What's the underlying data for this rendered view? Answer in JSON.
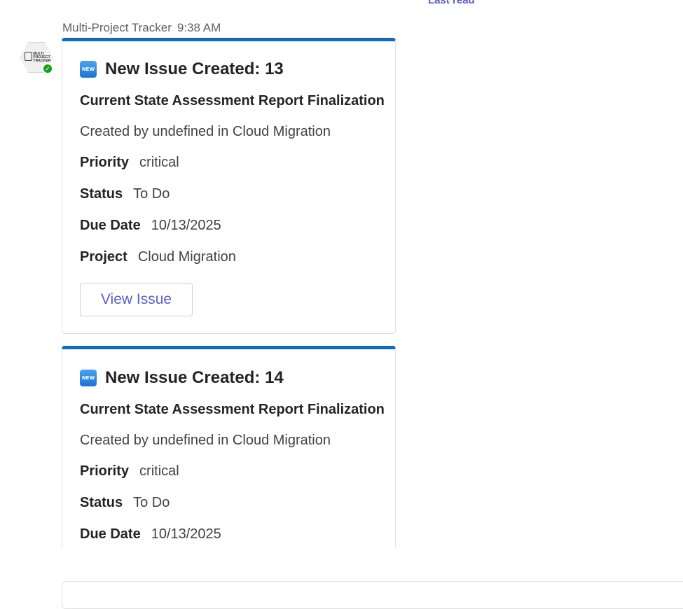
{
  "divider": {
    "last_read_label": "Last read"
  },
  "message": {
    "sender": "Multi-Project Tracker",
    "time": "9:38 AM",
    "avatar": {
      "label_lines": [
        "MULTI",
        "PROJECT",
        "TRACKER"
      ],
      "icon": "clipboard-check-icon",
      "presence": "available",
      "presence_color": "#13a10e"
    }
  },
  "colors": {
    "accent": "#0f6cbd",
    "button_text": "#5b5fc7"
  },
  "cards": [
    {
      "badge": "NEW",
      "title": "New Issue Created: 13",
      "subtitle": "Current State Assessment Report Finalization",
      "created": "Created by undefined in Cloud Migration",
      "facts": [
        {
          "key": "Priority",
          "value": "critical"
        },
        {
          "key": "Status",
          "value": "To Do"
        },
        {
          "key": "Due Date",
          "value": "10/13/2025"
        },
        {
          "key": "Project",
          "value": "Cloud Migration"
        }
      ],
      "button": "View Issue"
    },
    {
      "badge": "NEW",
      "title": "New Issue Created: 14",
      "subtitle": "Current State Assessment Report Finalization",
      "created": "Created by undefined in Cloud Migration",
      "facts": [
        {
          "key": "Priority",
          "value": "critical"
        },
        {
          "key": "Status",
          "value": "To Do"
        },
        {
          "key": "Due Date",
          "value": "10/13/2025"
        }
      ]
    }
  ]
}
